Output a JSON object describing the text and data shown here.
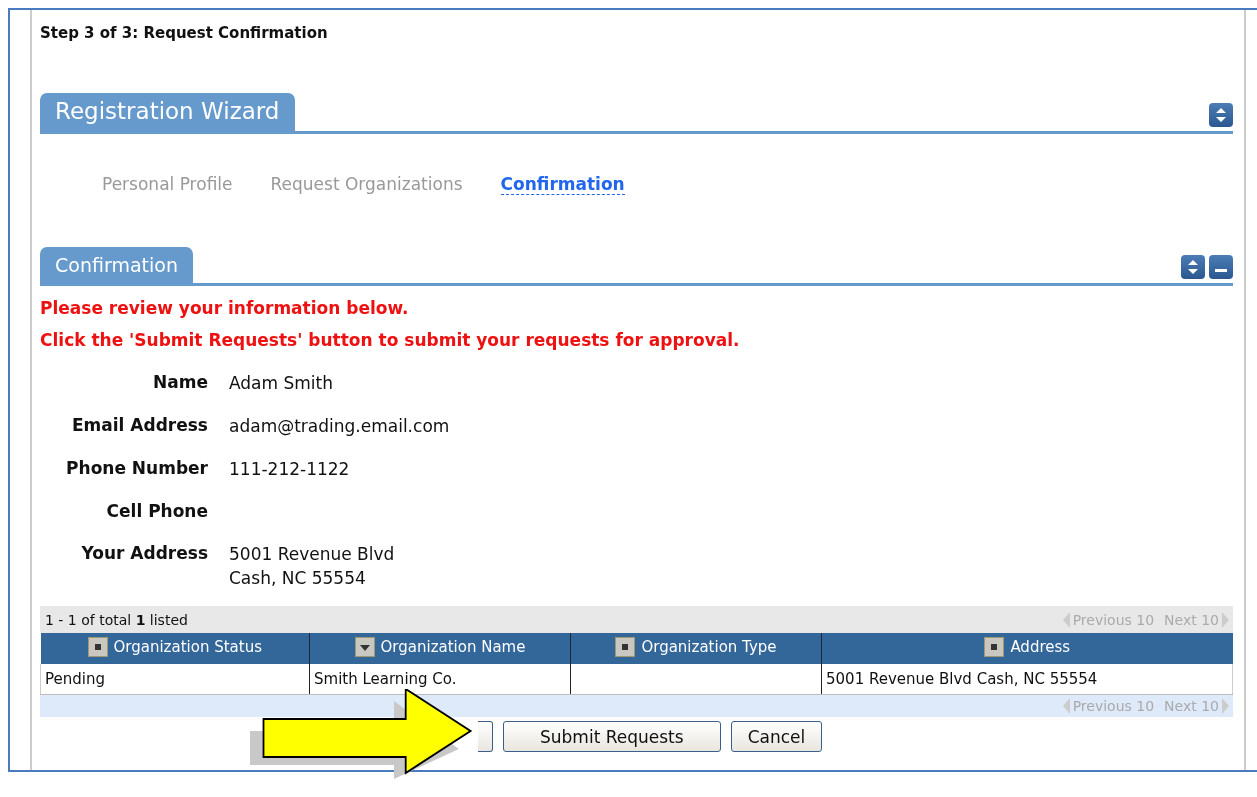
{
  "page_title": "Step 3 of 3: Request Confirmation",
  "wizard": {
    "title": "Registration Wizard",
    "steps": [
      {
        "label": "Personal Profile",
        "selected": false
      },
      {
        "label": "Request Organizations",
        "selected": false
      },
      {
        "label": "Confirmation",
        "selected": true
      }
    ]
  },
  "confirmation": {
    "title": "Confirmation",
    "messages": [
      "Please review your information below.",
      "Click the 'Submit Requests' button to submit your requests for approval."
    ],
    "fields": [
      {
        "label": "Name",
        "lines": [
          "Adam Smith"
        ]
      },
      {
        "label": "Email Address",
        "lines": [
          "adam@trading.email.com"
        ]
      },
      {
        "label": "Phone Number",
        "lines": [
          "111-212-1122"
        ]
      },
      {
        "label": "Cell Phone"
      },
      {
        "label": "Your Address",
        "lines": [
          "5001 Revenue Blvd",
          "Cash, NC 55554"
        ]
      }
    ]
  },
  "table": {
    "summary": "1 - 1 of total **1** listed",
    "pager_top": {
      "previous": "Previous 10",
      "next": "Next 10"
    },
    "columns": [
      {
        "label": "Organization Status",
        "sorted": false
      },
      {
        "label": "Organization Name",
        "sorted": true
      },
      {
        "label": "Organization Type",
        "sorted": false
      },
      {
        "label": "Address",
        "sorted": false
      }
    ],
    "rows": [
      [
        "Pending",
        "Smith Learning Co.",
        "",
        "5001 Revenue Blvd Cash, NC 55554"
      ]
    ],
    "pager_bottom": {
      "previous": "Previous 10",
      "next": "Next 10"
    }
  },
  "buttons": [
    {
      "kind": "hidden"
    },
    {
      "label": "Submit Requests",
      "kind": "normal"
    },
    {
      "label": "Cancel",
      "kind": "normal"
    }
  ]
}
